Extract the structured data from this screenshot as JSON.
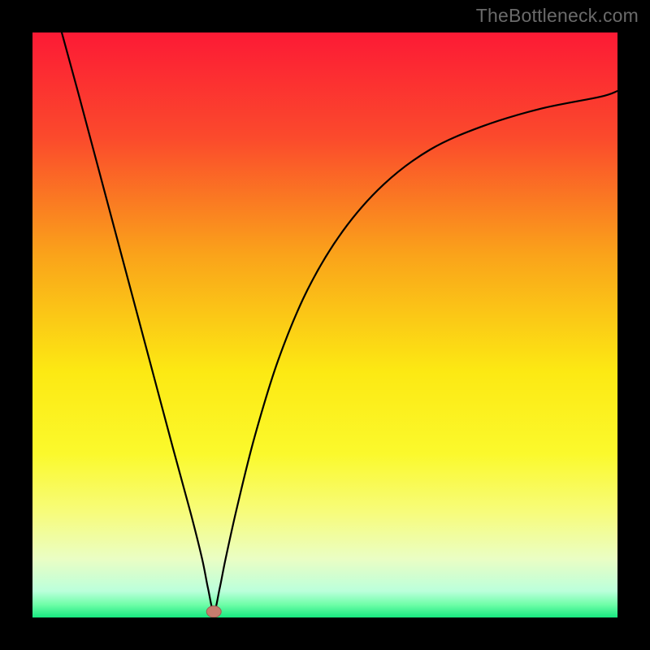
{
  "attribution": "TheBottleneck.com",
  "colors": {
    "frame": "#000000",
    "curve": "#000000",
    "marker_fill": "#c77d6e",
    "marker_stroke": "#9d5e52",
    "gradient_stops": [
      {
        "offset": 0.0,
        "color": "#fc1a35"
      },
      {
        "offset": 0.18,
        "color": "#fb4a2c"
      },
      {
        "offset": 0.38,
        "color": "#faa31a"
      },
      {
        "offset": 0.58,
        "color": "#fce913"
      },
      {
        "offset": 0.72,
        "color": "#fbf92c"
      },
      {
        "offset": 0.82,
        "color": "#f7fc7b"
      },
      {
        "offset": 0.9,
        "color": "#eafec4"
      },
      {
        "offset": 0.955,
        "color": "#bbffdb"
      },
      {
        "offset": 0.978,
        "color": "#6ffea8"
      },
      {
        "offset": 1.0,
        "color": "#17e87f"
      }
    ]
  },
  "chart_data": {
    "type": "line",
    "title": "",
    "xlabel": "",
    "ylabel": "",
    "xlim": [
      0,
      100
    ],
    "ylim": [
      0,
      100
    ],
    "grid": false,
    "legend": false,
    "marker": {
      "x": 31,
      "y": 1
    },
    "series": [
      {
        "name": "curve",
        "x": [
          5,
          8,
          12,
          16,
          20,
          24,
          27,
          29,
          30,
          31,
          32,
          33,
          35,
          38,
          42,
          47,
          53,
          60,
          68,
          77,
          87,
          97,
          100
        ],
        "y": [
          100,
          89,
          74,
          59,
          44,
          29,
          18,
          10,
          5,
          1,
          5,
          10,
          19,
          31,
          44,
          56,
          66,
          74,
          80,
          84,
          87,
          89,
          90
        ]
      }
    ]
  }
}
